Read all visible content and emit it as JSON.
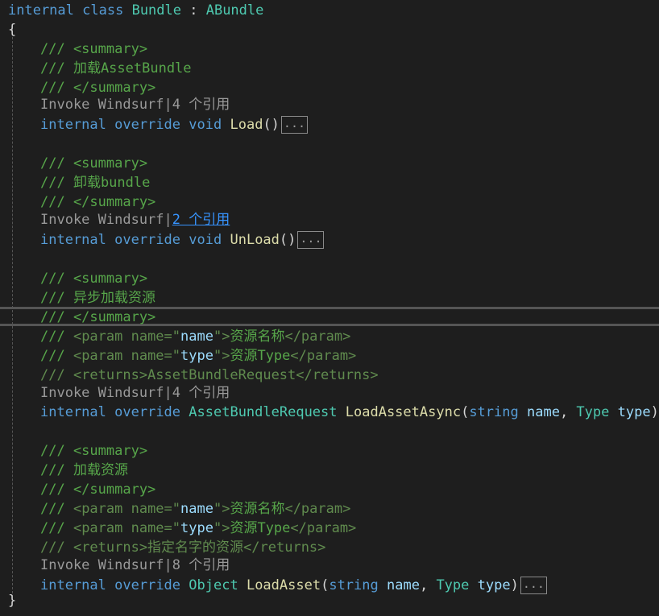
{
  "code": {
    "class_decl": {
      "kw1": "internal",
      "kw2": "class",
      "name": "Bundle",
      "sep": " : ",
      "base": "ABundle"
    },
    "open_brace": "{",
    "close_brace": "}",
    "lens_prefix": "Invoke Windsurf",
    "lens_sep": "|",
    "kw_internal": "internal",
    "kw_override": "override",
    "kw_void": "void",
    "kw_string": "string",
    "blocks": [
      {
        "doc": [
          "/// <summary>",
          "/// 加载AssetBundle",
          "/// </summary>"
        ],
        "refs": "4 个引用",
        "method": "Load",
        "params_text": "()",
        "collapsed": "..."
      },
      {
        "doc": [
          "/// <summary>",
          "/// 卸载bundle",
          "/// </summary>"
        ],
        "refs": "2 个引用",
        "method": "UnLoad",
        "params_text": "()",
        "collapsed": "..."
      },
      {
        "doc": [
          "/// <summary>",
          "/// 异步加载资源",
          "/// </summary>"
        ],
        "param_docs": [
          {
            "pre": "/// ",
            "open": "<param name=\"",
            "attr": "name",
            "mid": "\">",
            "text": "资源名称",
            "close": "</param>"
          },
          {
            "pre": "/// ",
            "open": "<param name=\"",
            "attr": "type",
            "mid": "\">",
            "text": "资源Type",
            "close": "</param>"
          }
        ],
        "returns_doc": "/// <returns>AssetBundleRequest</returns>",
        "refs": "4 个引用",
        "return_type": "AssetBundleRequest",
        "method": "LoadAssetAsync",
        "p1_name": "name",
        "p2_type": "Type",
        "p2_name": "type",
        "collapsed": "..."
      },
      {
        "doc": [
          "/// <summary>",
          "/// 加载资源",
          "/// </summary>"
        ],
        "param_docs": [
          {
            "pre": "/// ",
            "open": "<param name=\"",
            "attr": "name",
            "mid": "\">",
            "text": "资源名称",
            "close": "</param>"
          },
          {
            "pre": "/// ",
            "open": "<param name=\"",
            "attr": "type",
            "mid": "\">",
            "text": "资源Type",
            "close": "</param>"
          }
        ],
        "returns_doc": "/// <returns>指定名字的资源</returns>",
        "refs": "8 个引用",
        "return_type": "Object",
        "method": "LoadAsset",
        "p1_name": "name",
        "p2_type": "Type",
        "p2_name": "type",
        "collapsed": "..."
      }
    ]
  },
  "colors": {
    "background": "#1e1e1e",
    "keyword": "#569cd6",
    "type": "#4ec9b0",
    "method": "#dcdcaa",
    "comment": "#57a64a",
    "codelens_link": "#3794ff"
  }
}
